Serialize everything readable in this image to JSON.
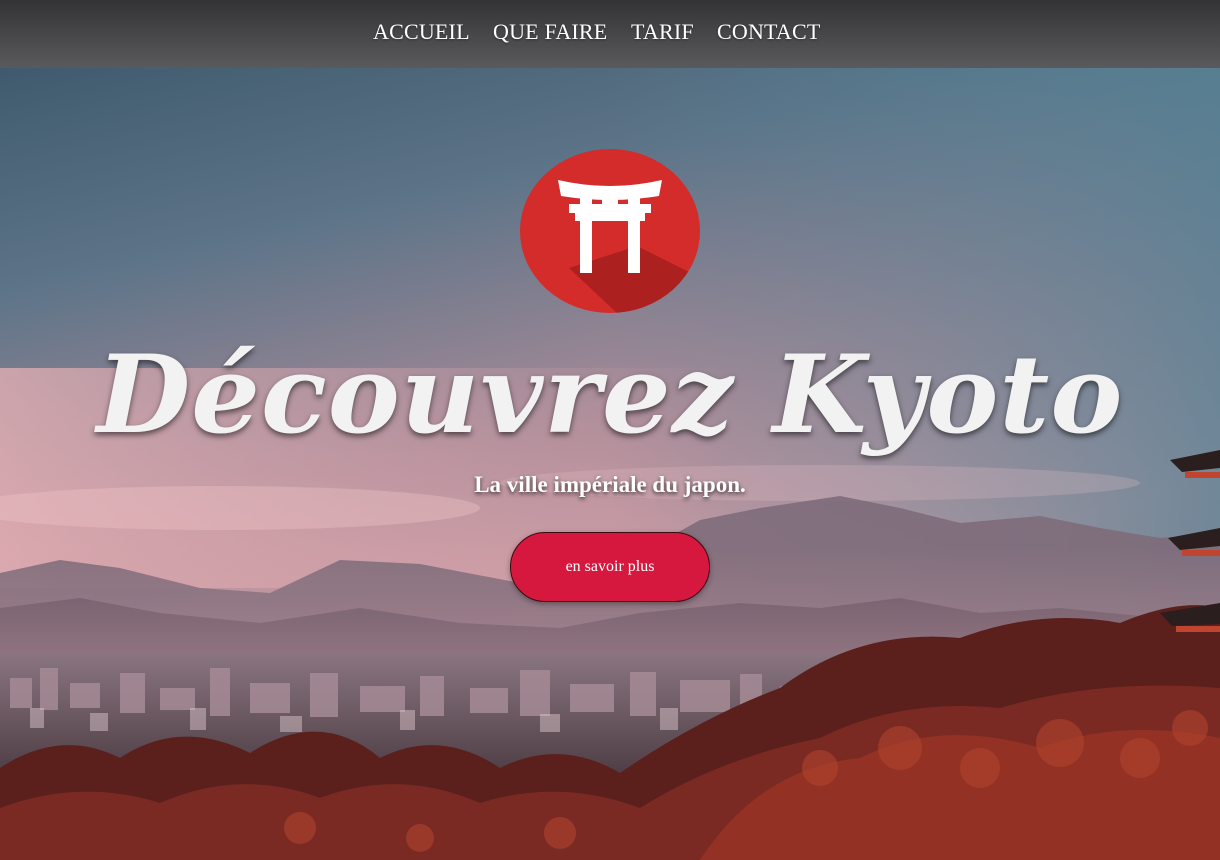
{
  "nav": {
    "items": [
      {
        "label": "ACCUEIL"
      },
      {
        "label": "QUE FAIRE"
      },
      {
        "label": "TARIF"
      },
      {
        "label": "CONTACT"
      }
    ]
  },
  "hero": {
    "logo_icon": "torii-gate-icon",
    "title": "Découvrez Kyoto",
    "subtitle": "La ville impériale du japon.",
    "cta_label": "en savoir plus",
    "background": "kyoto-skyline-sunset"
  },
  "colors": {
    "accent": "#d6183f",
    "logo_red": "#d42b2b",
    "navbar": "#4a4a4c"
  }
}
